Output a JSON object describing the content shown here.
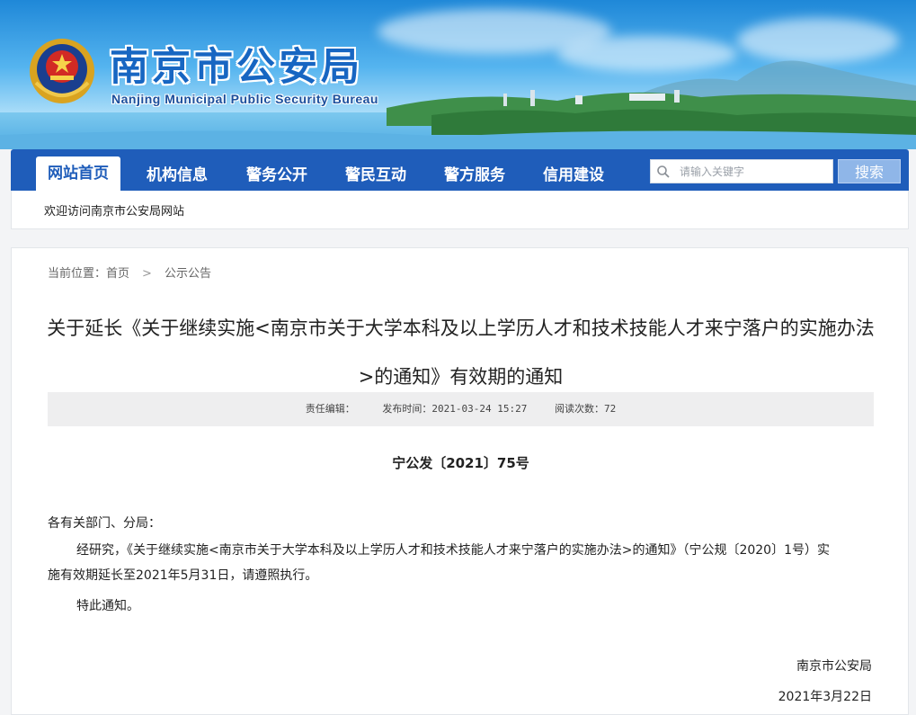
{
  "header": {
    "site_title": "南京市公安局",
    "site_subtitle": "Nanjing Municipal Public Security Bureau"
  },
  "nav": {
    "items": [
      {
        "label": "网站首页",
        "active": true
      },
      {
        "label": "机构信息"
      },
      {
        "label": "警务公开"
      },
      {
        "label": "警民互动"
      },
      {
        "label": "警方服务"
      },
      {
        "label": "信用建设"
      }
    ],
    "search_placeholder": "请输入关键字",
    "search_button": "搜索"
  },
  "welcome": "欢迎访问南京市公安局网站",
  "breadcrumb": {
    "prefix": "当前位置：",
    "home": "首页",
    "separator": ">",
    "current": "公示公告"
  },
  "article": {
    "title": "关于延长《关于继续实施<南京市关于大学本科及以上学历人才和技术技能人才来宁落户的实施办法>的通知》有效期的通知",
    "meta": {
      "editor": "责任编辑：",
      "publish_time": "发布时间：2021-03-24 15:27",
      "views": "阅读次数：72"
    },
    "doc_number": "宁公发〔2021〕75号",
    "addressee": "各有关部门、分局：",
    "body": [
      "经研究，《关于继续实施<南京市关于大学本科及以上学历人才和技术技能人才来宁落户的实施办法>的通知》（宁公规〔2020〕1号）实施有效期延长至2021年5月31日，请遵照执行。",
      "特此通知。"
    ],
    "signature_org": "南京市公安局",
    "signature_date": "2021年3月22日"
  },
  "colors": {
    "nav_bg": "#1f5dba",
    "title_blue": "#1766c2",
    "search_btn": "#8fb6e8"
  }
}
